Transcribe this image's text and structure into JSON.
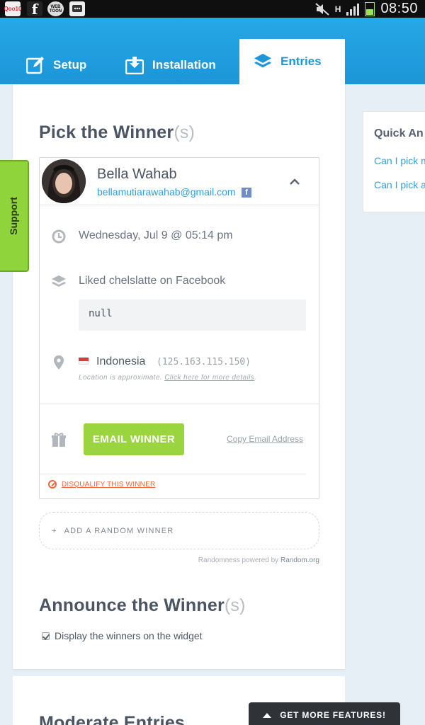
{
  "status_bar": {
    "apps": [
      "Qoo10",
      "f",
      "WEB TOON",
      "BBM"
    ],
    "network": "H",
    "time": "08:50"
  },
  "tabs": [
    {
      "label": "Setup",
      "icon": "edit-icon"
    },
    {
      "label": "Installation",
      "icon": "download-icon"
    },
    {
      "label": "Entries",
      "icon": "layers-icon",
      "active": true
    }
  ],
  "pick": {
    "title": "Pick the Winner",
    "title_suffix": "(s)"
  },
  "winner": {
    "name": "Bella Wahab",
    "email": "bellamutiarawahab@gmail.com",
    "source_badge": "f",
    "date": "Wednesday, Jul 9 @ 05:14 pm",
    "action": "Liked chelslatte on Facebook",
    "action_value": "null",
    "country": "Indonesia",
    "ip": "(125.163.115.150)",
    "approx_note": "Location is approximate.",
    "approx_link": "Click here for more details",
    "approx_end": ".",
    "email_button": "EMAIL WINNER",
    "copy_email": "Copy Email Address",
    "disqualify": "DISQUALIFY THIS WINNER"
  },
  "add_random": {
    "plus": "+",
    "label": "ADD A RANDOM WINNER"
  },
  "powered": {
    "text": "Randomness powered by",
    "org": "Random.org"
  },
  "announce": {
    "title": "Announce the Winner",
    "title_suffix": "(s)",
    "checkbox_label": "Display the winners on the widget",
    "checked": true
  },
  "moderate": {
    "title": "Moderate Entries"
  },
  "quick_answers": {
    "title": "Quick An",
    "links": [
      "Can I pick m",
      "Can I pick a"
    ]
  },
  "support": {
    "label": "Support"
  },
  "more_features": {
    "label": "GET MORE FEATURES!"
  },
  "colors": {
    "header_blue": "#1f9bdb",
    "accent_green": "#9ad43f",
    "link_blue": "#2aa0e0",
    "danger_orange": "#f0653c"
  }
}
